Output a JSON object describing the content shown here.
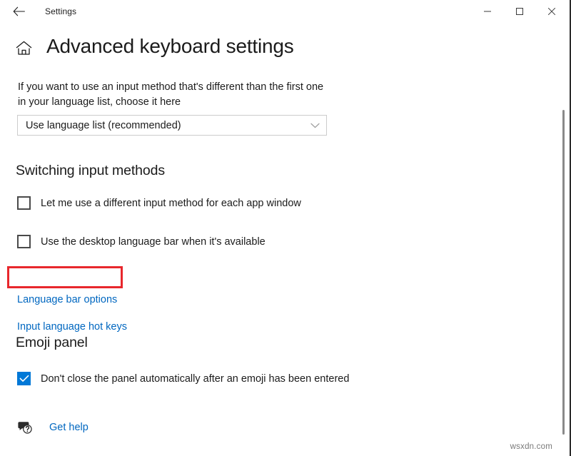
{
  "window": {
    "app_title": "Settings",
    "back_icon": "back-arrow-icon",
    "controls": {
      "minimize": "minimize-icon",
      "maximize": "maximize-icon",
      "close": "close-icon"
    }
  },
  "page": {
    "home_icon": "home-icon",
    "title": "Advanced keyboard settings",
    "description": "If you want to use an input method that's different than the first one in your language list, choose it here"
  },
  "override_dropdown": {
    "name": "input-method-override-dropdown",
    "value": "Use language list (recommended)",
    "chevron_icon": "chevron-down-icon"
  },
  "switching_section": {
    "heading": "Switching input methods",
    "checkboxes": [
      {
        "label": "Let me use a different input method for each app window",
        "checked": false
      },
      {
        "label": "Use the desktop language bar when it's available",
        "checked": false
      }
    ],
    "links": [
      {
        "label": "Language bar options",
        "highlighted": true
      },
      {
        "label": "Input language hot keys",
        "highlighted": false
      }
    ]
  },
  "emoji_section": {
    "heading": "Emoji panel",
    "checkboxes": [
      {
        "label": "Don't close the panel automatically after an emoji has been entered",
        "checked": true
      }
    ]
  },
  "footer": {
    "get_help_icon": "help-bubble-icon",
    "get_help_label": "Get help"
  },
  "watermark": "wsxdn.com",
  "colors": {
    "accent_blue": "#0078d7",
    "link_blue": "#0067c0",
    "highlight_red": "#e8272c",
    "text": "#1b1b1b",
    "background": "#ffffff"
  },
  "scrollbar": {
    "name": "vertical-scrollbar"
  }
}
